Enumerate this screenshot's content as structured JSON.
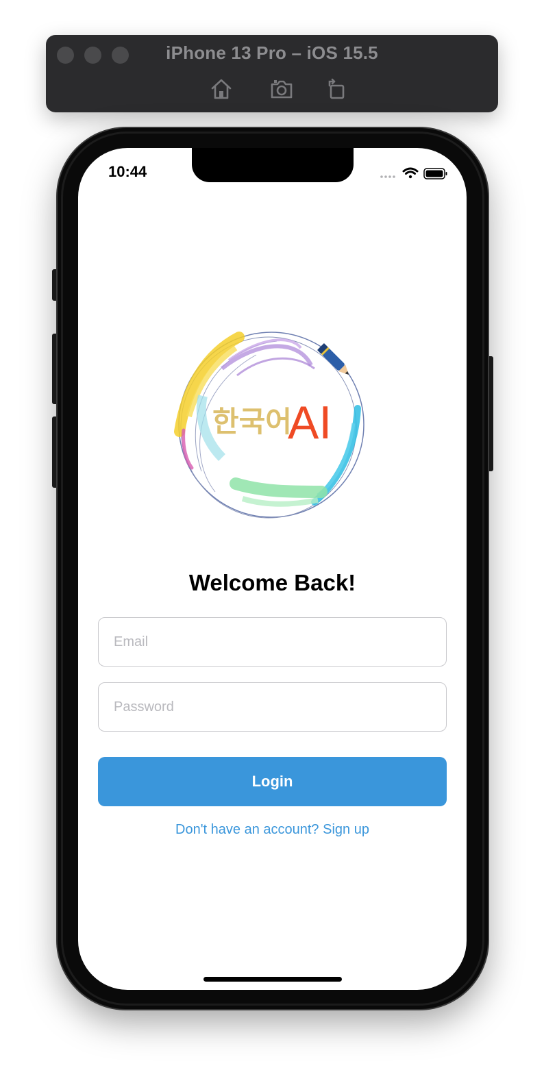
{
  "simulator": {
    "title": "iPhone 13 Pro – iOS 15.5",
    "icons": [
      "home-icon",
      "screenshot-icon",
      "rotate-icon"
    ]
  },
  "status_bar": {
    "time": "10:44",
    "icons": [
      "cellular-icon",
      "wifi-icon",
      "battery-icon"
    ]
  },
  "logo": {
    "korean_text": "한국어",
    "ai_text": "AI"
  },
  "login": {
    "heading": "Welcome Back!",
    "email_placeholder": "Email",
    "email_value": "",
    "password_placeholder": "Password",
    "password_value": "",
    "login_label": "Login",
    "signup_link": "Don't have an account? Sign up"
  },
  "colors": {
    "accent": "#3a96db",
    "korean_text": "#ddc06f",
    "ai_text": "#ef4a24"
  }
}
